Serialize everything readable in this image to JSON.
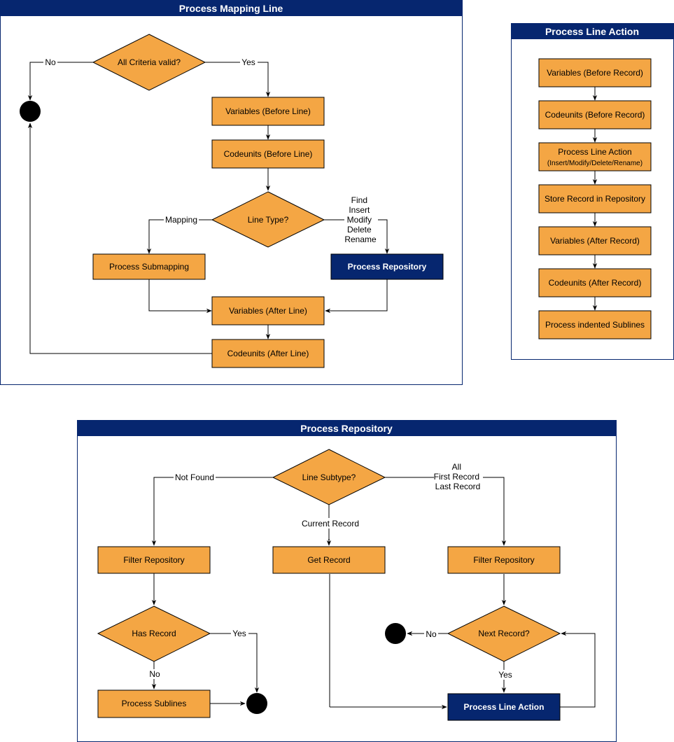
{
  "colors": {
    "pool_header": "#06266f",
    "process_fill": "#f4a644",
    "subprocess_fill": "#06266f",
    "terminal": "#000000"
  },
  "pools": {
    "mapping_line": {
      "title": "Process Mapping Line",
      "decision_criteria": "All Criteria valid?",
      "label_no": "No",
      "label_yes": "Yes",
      "variables_before_line": "Variables (Before Line)",
      "codeunits_before_line": "Codeunits (Before Line)",
      "decision_line_type": "Line Type?",
      "label_mapping": "Mapping",
      "label_repo_types": [
        "Find",
        "Insert",
        "Modify",
        "Delete",
        "Rename"
      ],
      "process_submapping": "Process Submapping",
      "process_repository": "Process Repository",
      "variables_after_line": "Variables (After Line)",
      "codeunits_after_line": "Codeunits (After Line)"
    },
    "line_action": {
      "title": "Process Line Action",
      "steps": [
        {
          "label": "Variables (Before Record)",
          "sub": ""
        },
        {
          "label": "Codeunits (Before Record)",
          "sub": ""
        },
        {
          "label": "Process Line Action",
          "sub": "(Insert/Modify/Delete/Rename)"
        },
        {
          "label": "Store Record in Repository",
          "sub": ""
        },
        {
          "label": "Variables (After Record)",
          "sub": ""
        },
        {
          "label": "Codeunits (After Record)",
          "sub": ""
        },
        {
          "label": "Process indented Sublines",
          "sub": ""
        }
      ]
    },
    "repository": {
      "title": "Process Repository",
      "decision_subtype": "Line Subtype?",
      "label_not_found": "Not Found",
      "label_current_record": "Current Record",
      "label_multi": [
        "All",
        "First Record",
        "Last Record"
      ],
      "filter_repository_left": "Filter Repository",
      "get_record": "Get Record",
      "filter_repository_right": "Filter Repository",
      "decision_has_record": "Has Record",
      "label_has_yes": "Yes",
      "label_has_no": "No",
      "process_sublines": "Process Sublines",
      "decision_next_record": "Next Record?",
      "label_next_no": "No",
      "label_next_yes": "Yes",
      "process_line_action": "Process Line Action"
    }
  }
}
